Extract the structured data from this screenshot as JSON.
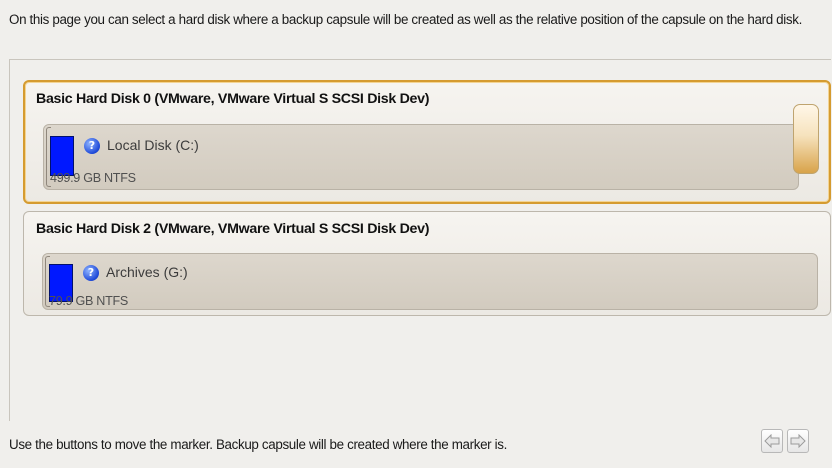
{
  "intro_text": "On this page you can select a hard disk where a backup capsule will be created as well as the relative position of the capsule on the hard disk.",
  "disks": [
    {
      "title": "Basic Hard Disk 0 (VMware, VMware Virtual S SCSI Disk Dev)",
      "selected": true,
      "partition": {
        "name": "Local Disk (C:)",
        "size": "499.9 GB NTFS",
        "icon": "help-icon"
      }
    },
    {
      "title": "Basic Hard Disk 2 (VMware, VMware Virtual S SCSI Disk Dev)",
      "selected": false,
      "partition": {
        "name": "Archives (G:)",
        "size": "79.9 GB NTFS",
        "icon": "help-icon"
      }
    }
  ],
  "footer_text": "Use the buttons to move the marker. Backup capsule will be created where the marker is.",
  "nav": {
    "left_icon": "arrow-left-icon",
    "right_icon": "arrow-right-icon"
  },
  "colors": {
    "partition_fill": "#0018ff",
    "selected_border": "#d59b30"
  }
}
